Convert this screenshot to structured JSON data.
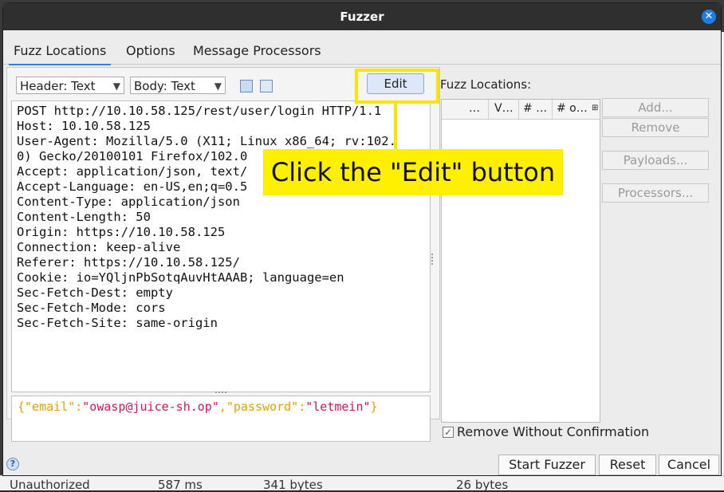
{
  "window": {
    "title": "Fuzzer"
  },
  "tabs": [
    "Fuzz Locations",
    "Options",
    "Message Processors"
  ],
  "toolbar": {
    "header_view": "Header: Text",
    "body_view": "Body: Text",
    "edit_label": "Edit"
  },
  "request": {
    "lines": [
      "POST http://10.10.58.125/rest/user/login HTTP/1.1",
      "Host: 10.10.58.125",
      "User-Agent: Mozilla/5.0 (X11; Linux x86_64; rv:102.",
      "0) Gecko/20100101 Firefox/102.0",
      "Accept: application/json, text/",
      "Accept-Language: en-US,en;q=0.5",
      "Content-Type: application/json",
      "Content-Length: 50",
      "Origin: https://10.10.58.125",
      "Connection: keep-alive",
      "Referer: https://10.10.58.125/",
      "Cookie: io=YQljnPbSotqAuvHtAAAB; language=en",
      "Sec-Fetch-Dest: empty",
      "Sec-Fetch-Mode: cors",
      "Sec-Fetch-Site: same-origin"
    ],
    "body": {
      "open": "{",
      "key1": "\"email\"",
      "colon": ":",
      "val1": "\"owasp@juice-sh.op\"",
      "comma": ",",
      "key2": "\"password\"",
      "val2": "\"letmein\"",
      "close": "}"
    }
  },
  "fuzz_locations": {
    "label": "Fuzz Locations:",
    "columns": [
      "…",
      "V…",
      "# …",
      "# o…"
    ],
    "buttons": {
      "add": "Add...",
      "remove": "Remove",
      "payloads": "Payloads...",
      "processors": "Processors..."
    }
  },
  "options": {
    "remove_without_confirmation": "Remove Without Confirmation",
    "remove_checked": true
  },
  "footer": {
    "start": "Start Fuzzer",
    "reset": "Reset",
    "cancel": "Cancel"
  },
  "annotation": {
    "callout": "Click the \"Edit\" button"
  },
  "background": {
    "status": "Unauthorized",
    "time": "587 ms",
    "size1": "341 bytes",
    "size2": "26 bytes"
  },
  "colors": {
    "json_key": "#c2185b",
    "json_string": "#d4145a",
    "json_punct": "#e8a000",
    "highlight": "#f7e600",
    "callout_bg": "#fff000",
    "titlebar": "#2f2f2f",
    "accent": "#3b7bd8"
  }
}
